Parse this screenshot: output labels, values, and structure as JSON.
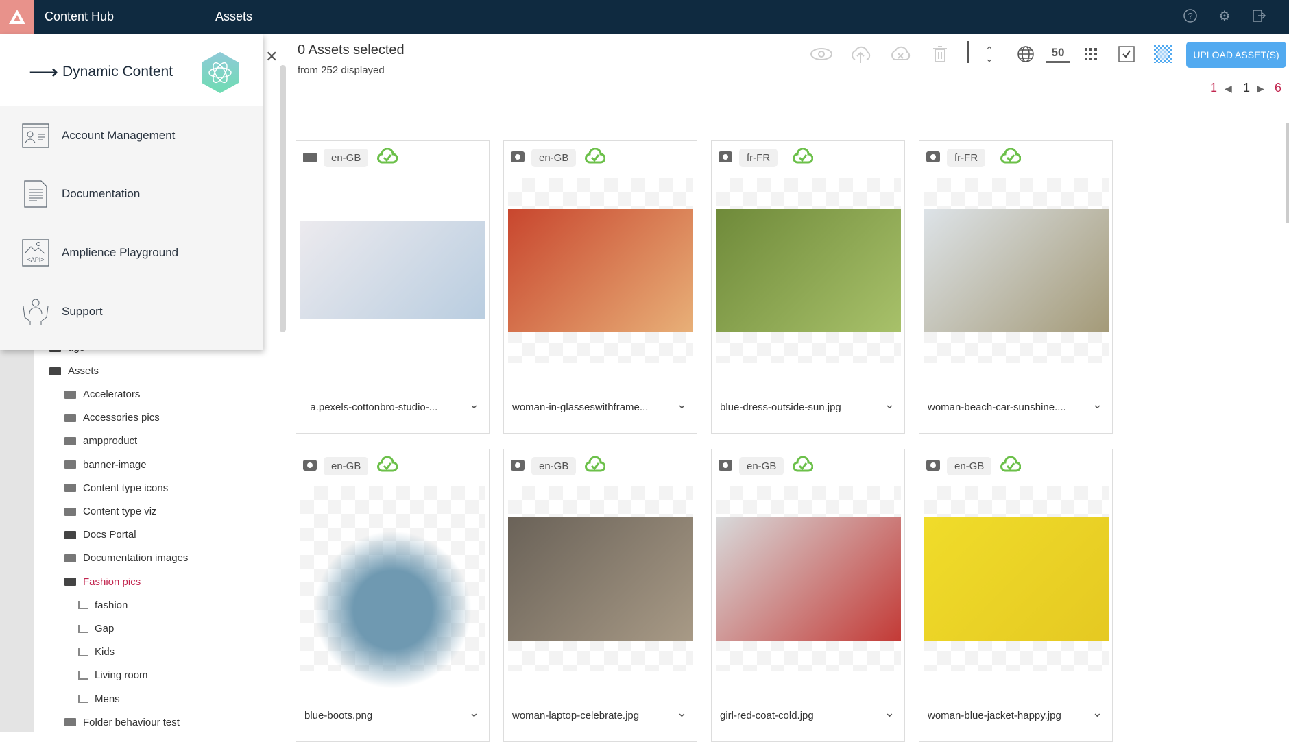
{
  "topbar": {
    "app_title": "Content Hub",
    "section": "Assets",
    "icons": [
      "help-icon",
      "gear-icon",
      "logout-icon"
    ]
  },
  "menu": {
    "header": "Dynamic Content",
    "items": [
      {
        "label": "Account Management",
        "icon": "account-card-icon"
      },
      {
        "label": "Documentation",
        "icon": "document-icon"
      },
      {
        "label": "Amplience Playground",
        "icon": "api-icon"
      },
      {
        "label": "Support",
        "icon": "support-hands-icon"
      }
    ]
  },
  "tree": {
    "partial": "ugo",
    "root": "Assets",
    "folders": [
      "Accelerators",
      "Accessories pics",
      "ampproduct",
      "banner-image",
      "Content type icons",
      "Content type viz",
      "Docs Portal",
      "Documentation images",
      "Fashion pics"
    ],
    "active": "Fashion pics",
    "subfolders": [
      "fashion",
      "Gap",
      "Kids",
      "Living room",
      "Mens"
    ],
    "after": "Folder behaviour test"
  },
  "selection": {
    "title": "0 Assets selected",
    "subtitle": "from 252 displayed"
  },
  "toolbar": {
    "page_size": "50",
    "upload_label": "UPLOAD ASSET(S)",
    "accent": "#52aaf0"
  },
  "pagination": {
    "first": "1",
    "current": "1",
    "last": "6"
  },
  "assets": [
    {
      "type": "video",
      "locale": "en-GB",
      "name": "_a.pexels-cottonbro-studio-...",
      "colors": [
        "#eceaee",
        "#b9cde0"
      ]
    },
    {
      "type": "image",
      "locale": "en-GB",
      "name": "woman-in-glasseswithframe...",
      "colors": [
        "#c8462e",
        "#e8b078"
      ]
    },
    {
      "type": "image",
      "locale": "fr-FR",
      "name": "blue-dress-outside-sun.jpg",
      "colors": [
        "#6f8a3a",
        "#a8c16a"
      ]
    },
    {
      "type": "image",
      "locale": "fr-FR",
      "name": "woman-beach-car-sunshine....",
      "colors": [
        "#dde3e8",
        "#a49a78"
      ]
    },
    {
      "type": "image",
      "locale": "en-GB",
      "name": "blue-boots.png",
      "colors": [
        "#6f99b1",
        "#c9b79e"
      ]
    },
    {
      "type": "image",
      "locale": "en-GB",
      "name": "woman-laptop-celebrate.jpg",
      "colors": [
        "#6a6258",
        "#a89a86"
      ]
    },
    {
      "type": "image",
      "locale": "en-GB",
      "name": "girl-red-coat-cold.jpg",
      "colors": [
        "#d8dadb",
        "#c33a36"
      ]
    },
    {
      "type": "image",
      "locale": "en-GB",
      "name": "woman-blue-jacket-happy.jpg",
      "colors": [
        "#f0dc2a",
        "#e5c922"
      ]
    }
  ]
}
